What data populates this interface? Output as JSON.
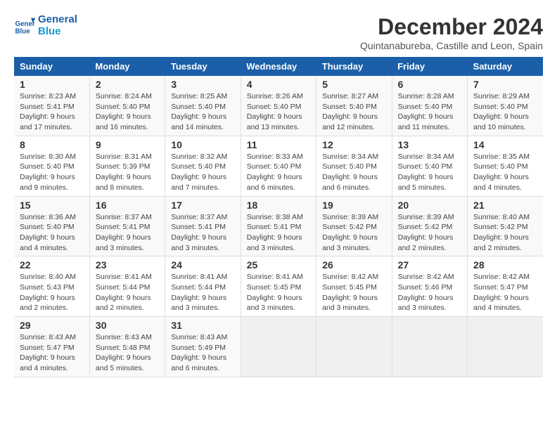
{
  "logo": {
    "line1": "General",
    "line2": "Blue"
  },
  "title": "December 2024",
  "subtitle": "Quintanabureba, Castille and Leon, Spain",
  "days_of_week": [
    "Sunday",
    "Monday",
    "Tuesday",
    "Wednesday",
    "Thursday",
    "Friday",
    "Saturday"
  ],
  "weeks": [
    [
      {
        "day": "1",
        "sunrise": "Sunrise: 8:23 AM",
        "sunset": "Sunset: 5:41 PM",
        "daylight": "Daylight: 9 hours and 17 minutes."
      },
      {
        "day": "2",
        "sunrise": "Sunrise: 8:24 AM",
        "sunset": "Sunset: 5:40 PM",
        "daylight": "Daylight: 9 hours and 16 minutes."
      },
      {
        "day": "3",
        "sunrise": "Sunrise: 8:25 AM",
        "sunset": "Sunset: 5:40 PM",
        "daylight": "Daylight: 9 hours and 14 minutes."
      },
      {
        "day": "4",
        "sunrise": "Sunrise: 8:26 AM",
        "sunset": "Sunset: 5:40 PM",
        "daylight": "Daylight: 9 hours and 13 minutes."
      },
      {
        "day": "5",
        "sunrise": "Sunrise: 8:27 AM",
        "sunset": "Sunset: 5:40 PM",
        "daylight": "Daylight: 9 hours and 12 minutes."
      },
      {
        "day": "6",
        "sunrise": "Sunrise: 8:28 AM",
        "sunset": "Sunset: 5:40 PM",
        "daylight": "Daylight: 9 hours and 11 minutes."
      },
      {
        "day": "7",
        "sunrise": "Sunrise: 8:29 AM",
        "sunset": "Sunset: 5:40 PM",
        "daylight": "Daylight: 9 hours and 10 minutes."
      }
    ],
    [
      {
        "day": "8",
        "sunrise": "Sunrise: 8:30 AM",
        "sunset": "Sunset: 5:40 PM",
        "daylight": "Daylight: 9 hours and 9 minutes."
      },
      {
        "day": "9",
        "sunrise": "Sunrise: 8:31 AM",
        "sunset": "Sunset: 5:39 PM",
        "daylight": "Daylight: 9 hours and 8 minutes."
      },
      {
        "day": "10",
        "sunrise": "Sunrise: 8:32 AM",
        "sunset": "Sunset: 5:40 PM",
        "daylight": "Daylight: 9 hours and 7 minutes."
      },
      {
        "day": "11",
        "sunrise": "Sunrise: 8:33 AM",
        "sunset": "Sunset: 5:40 PM",
        "daylight": "Daylight: 9 hours and 6 minutes."
      },
      {
        "day": "12",
        "sunrise": "Sunrise: 8:34 AM",
        "sunset": "Sunset: 5:40 PM",
        "daylight": "Daylight: 9 hours and 6 minutes."
      },
      {
        "day": "13",
        "sunrise": "Sunrise: 8:34 AM",
        "sunset": "Sunset: 5:40 PM",
        "daylight": "Daylight: 9 hours and 5 minutes."
      },
      {
        "day": "14",
        "sunrise": "Sunrise: 8:35 AM",
        "sunset": "Sunset: 5:40 PM",
        "daylight": "Daylight: 9 hours and 4 minutes."
      }
    ],
    [
      {
        "day": "15",
        "sunrise": "Sunrise: 8:36 AM",
        "sunset": "Sunset: 5:40 PM",
        "daylight": "Daylight: 9 hours and 4 minutes."
      },
      {
        "day": "16",
        "sunrise": "Sunrise: 8:37 AM",
        "sunset": "Sunset: 5:41 PM",
        "daylight": "Daylight: 9 hours and 3 minutes."
      },
      {
        "day": "17",
        "sunrise": "Sunrise: 8:37 AM",
        "sunset": "Sunset: 5:41 PM",
        "daylight": "Daylight: 9 hours and 3 minutes."
      },
      {
        "day": "18",
        "sunrise": "Sunrise: 8:38 AM",
        "sunset": "Sunset: 5:41 PM",
        "daylight": "Daylight: 9 hours and 3 minutes."
      },
      {
        "day": "19",
        "sunrise": "Sunrise: 8:39 AM",
        "sunset": "Sunset: 5:42 PM",
        "daylight": "Daylight: 9 hours and 3 minutes."
      },
      {
        "day": "20",
        "sunrise": "Sunrise: 8:39 AM",
        "sunset": "Sunset: 5:42 PM",
        "daylight": "Daylight: 9 hours and 2 minutes."
      },
      {
        "day": "21",
        "sunrise": "Sunrise: 8:40 AM",
        "sunset": "Sunset: 5:42 PM",
        "daylight": "Daylight: 9 hours and 2 minutes."
      }
    ],
    [
      {
        "day": "22",
        "sunrise": "Sunrise: 8:40 AM",
        "sunset": "Sunset: 5:43 PM",
        "daylight": "Daylight: 9 hours and 2 minutes."
      },
      {
        "day": "23",
        "sunrise": "Sunrise: 8:41 AM",
        "sunset": "Sunset: 5:44 PM",
        "daylight": "Daylight: 9 hours and 2 minutes."
      },
      {
        "day": "24",
        "sunrise": "Sunrise: 8:41 AM",
        "sunset": "Sunset: 5:44 PM",
        "daylight": "Daylight: 9 hours and 3 minutes."
      },
      {
        "day": "25",
        "sunrise": "Sunrise: 8:41 AM",
        "sunset": "Sunset: 5:45 PM",
        "daylight": "Daylight: 9 hours and 3 minutes."
      },
      {
        "day": "26",
        "sunrise": "Sunrise: 8:42 AM",
        "sunset": "Sunset: 5:45 PM",
        "daylight": "Daylight: 9 hours and 3 minutes."
      },
      {
        "day": "27",
        "sunrise": "Sunrise: 8:42 AM",
        "sunset": "Sunset: 5:46 PM",
        "daylight": "Daylight: 9 hours and 3 minutes."
      },
      {
        "day": "28",
        "sunrise": "Sunrise: 8:42 AM",
        "sunset": "Sunset: 5:47 PM",
        "daylight": "Daylight: 9 hours and 4 minutes."
      }
    ],
    [
      {
        "day": "29",
        "sunrise": "Sunrise: 8:43 AM",
        "sunset": "Sunset: 5:47 PM",
        "daylight": "Daylight: 9 hours and 4 minutes."
      },
      {
        "day": "30",
        "sunrise": "Sunrise: 8:43 AM",
        "sunset": "Sunset: 5:48 PM",
        "daylight": "Daylight: 9 hours and 5 minutes."
      },
      {
        "day": "31",
        "sunrise": "Sunrise: 8:43 AM",
        "sunset": "Sunset: 5:49 PM",
        "daylight": "Daylight: 9 hours and 6 minutes."
      },
      null,
      null,
      null,
      null
    ]
  ]
}
